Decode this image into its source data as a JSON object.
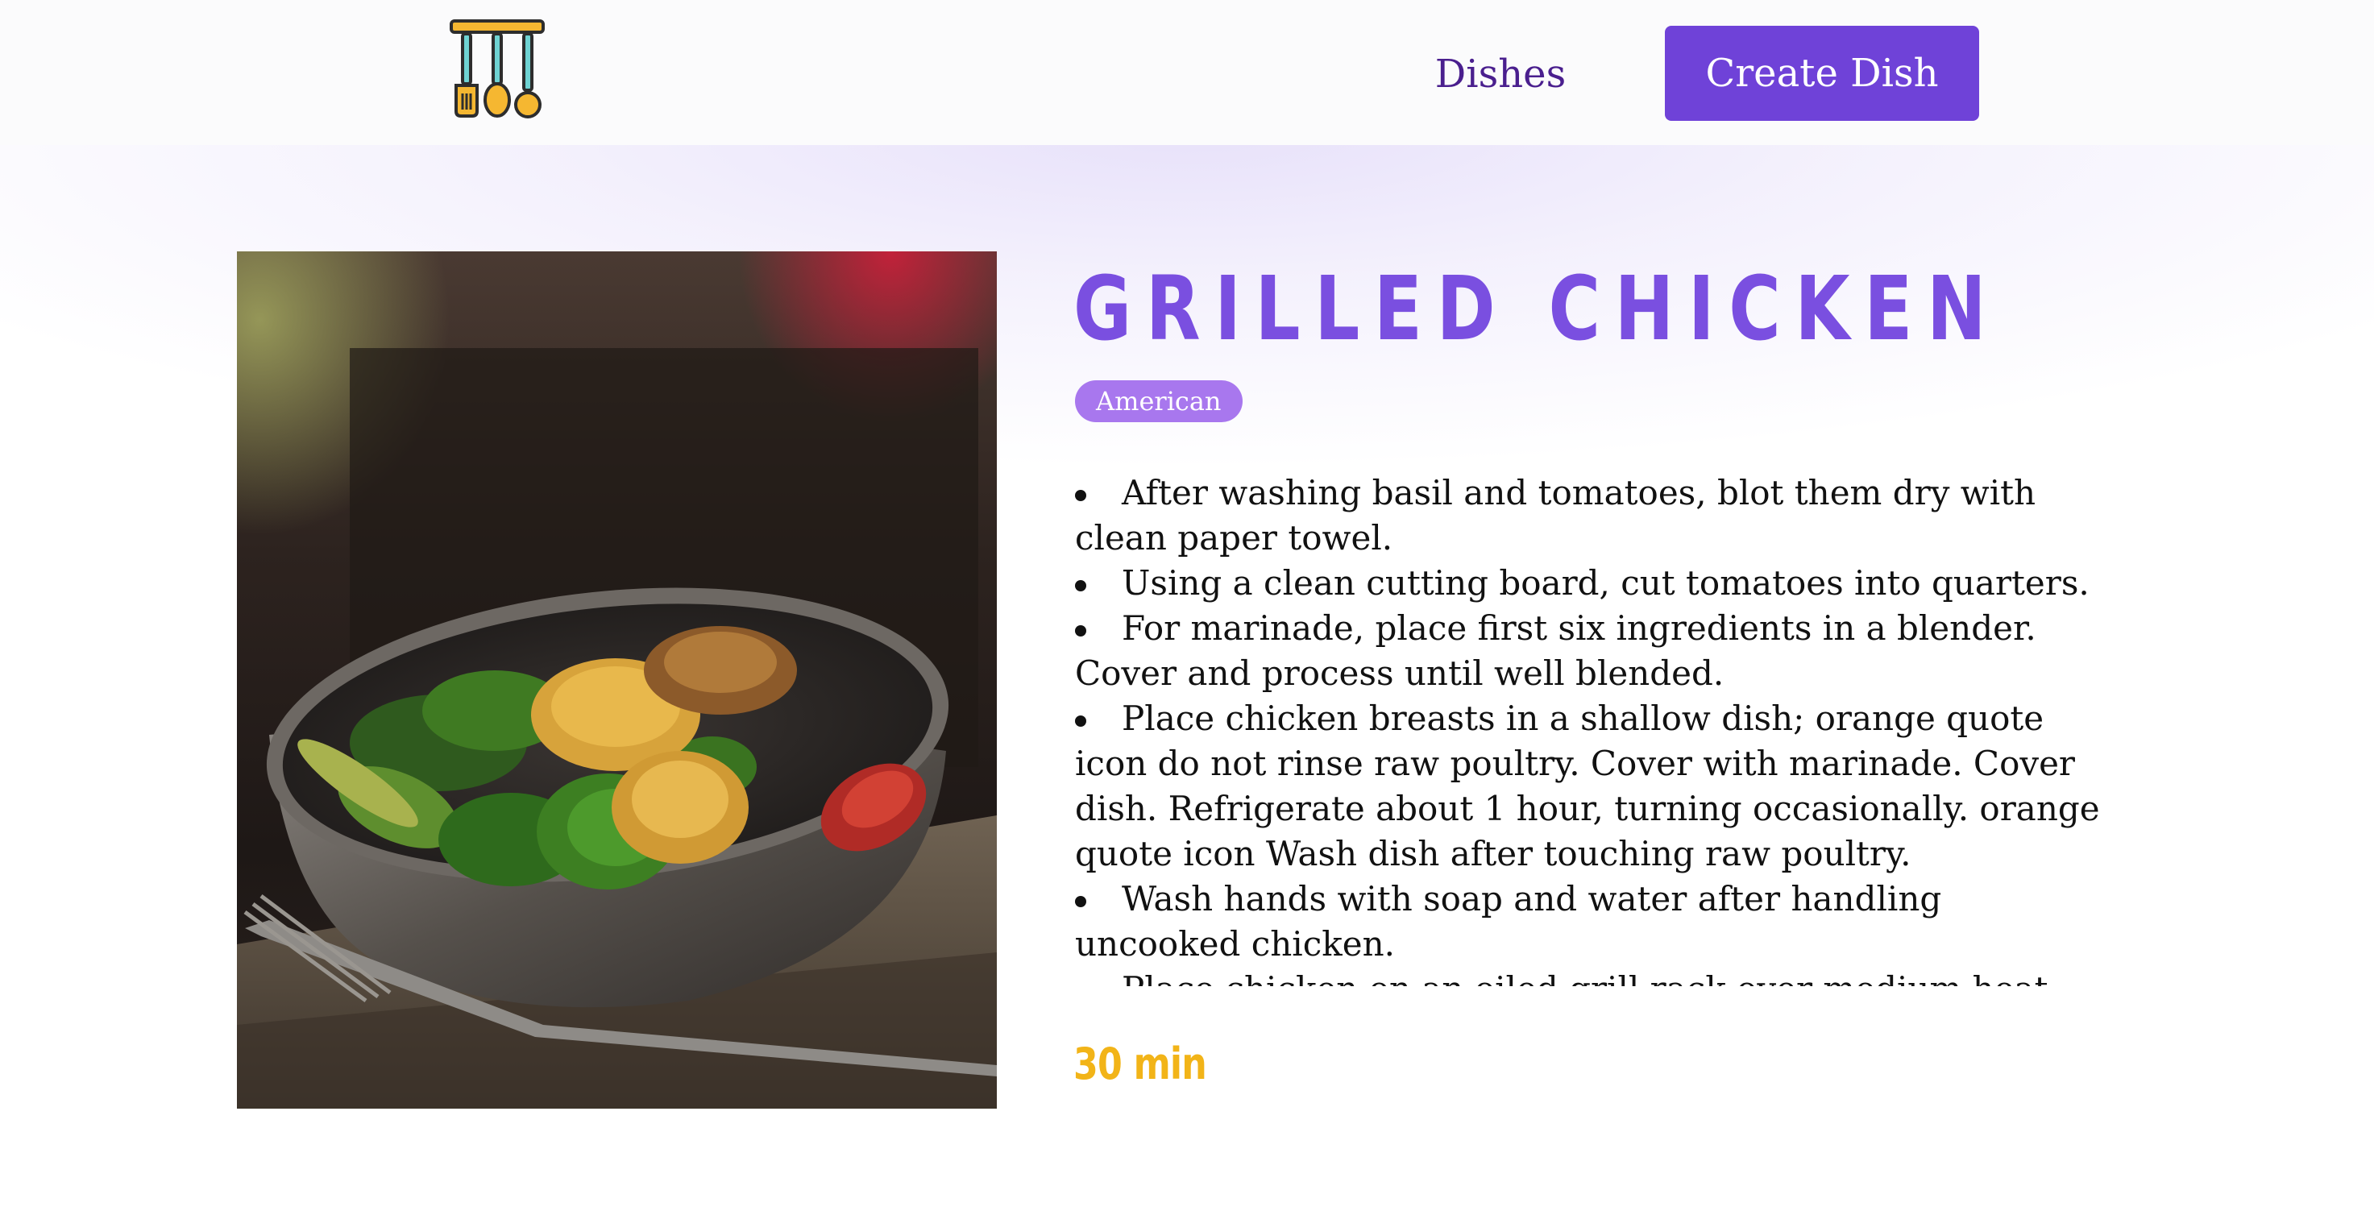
{
  "header": {
    "nav_dishes": "Dishes",
    "create_button": "Create Dish"
  },
  "dish": {
    "title": "GRILLED CHICKEN",
    "cuisine": "American",
    "cook_time": "30 min",
    "image_subject": "bowl-of-salad-photo",
    "instructions": [
      "After washing basil and tomatoes, blot them dry with clean paper towel.",
      "Using a clean cutting board, cut tomatoes into quarters.",
      "For marinade, place first six ingredients in a blender. Cover and process until well blended.",
      "Place chicken breasts in a shallow dish; orange quote icon do not rinse raw poultry. Cover with marinade. Cover dish. Refrigerate about 1 hour, turning occasionally. orange quote icon Wash dish after touching raw poultry.",
      "Wash hands with soap and water after handling uncooked chicken.",
      "Place chicken on an oiled grill rack over medium heat. orange"
    ]
  },
  "colors": {
    "brand_purple": "#6f42d8",
    "title_purple": "#7a4fe0",
    "badge_purple": "#a877ee",
    "nav_text": "#4a1f8e",
    "time_yellow": "#f2b418",
    "logo_yellow": "#f5b731",
    "logo_teal": "#6fd3d3"
  }
}
